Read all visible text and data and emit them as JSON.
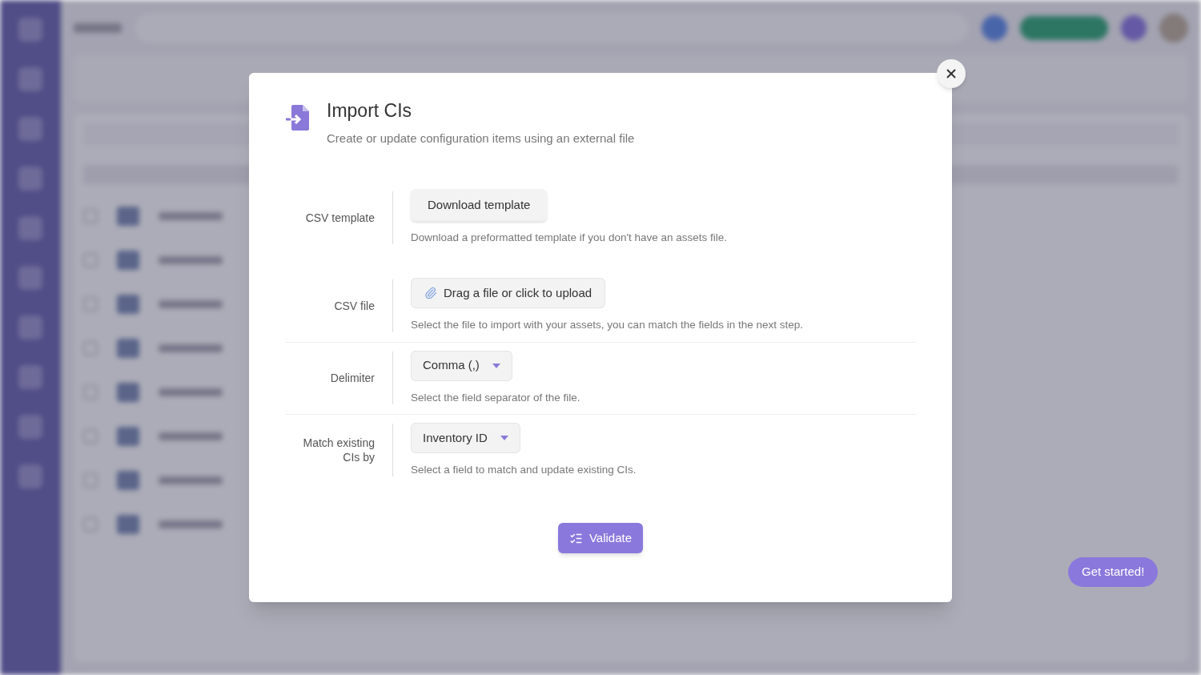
{
  "dialog": {
    "title": "Import CIs",
    "subtitle": "Create or update configuration items using an external file",
    "groups": [
      [
        {
          "label": "CSV template",
          "kind": "button",
          "control": "Download template",
          "help": "Download a preformatted template if you don't have an assets file."
        },
        {
          "label": "CSV file",
          "kind": "upload",
          "control": "Drag a file or click to upload",
          "help": "Select the file to import with your assets, you can match the fields in the next step."
        }
      ],
      [
        {
          "label": "Delimiter",
          "kind": "select",
          "control": "Comma (,)",
          "help": "Select the field separator of the file."
        }
      ],
      [
        {
          "label": "Match existing CIs by",
          "kind": "select",
          "control": "Inventory ID",
          "help": "Select a field to match and update existing CIs."
        }
      ]
    ],
    "submit": "Validate"
  },
  "help_button": "Get started!"
}
